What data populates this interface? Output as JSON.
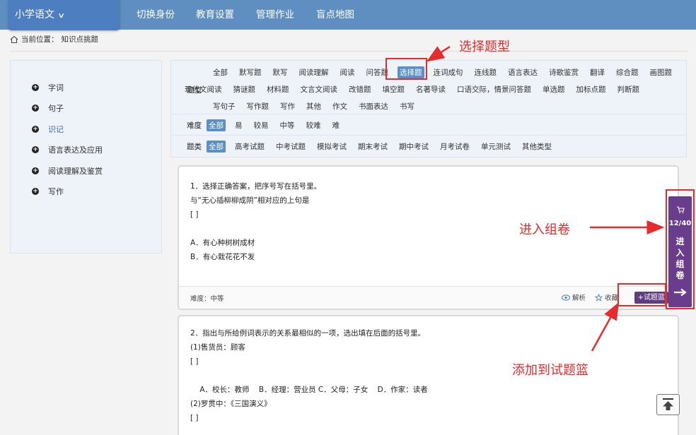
{
  "header": {
    "subject": "小学语文",
    "nav": [
      "切换身份",
      "教育设置",
      "管理作业",
      "盲点地图"
    ]
  },
  "breadcrumb": {
    "label": "当前位置：",
    "page": "知识点挑题"
  },
  "sidebar": {
    "items": [
      {
        "label": "字词",
        "active": false
      },
      {
        "label": "句子",
        "active": false
      },
      {
        "label": "识记",
        "active": true
      },
      {
        "label": "语言表达及应用",
        "active": false
      },
      {
        "label": "阅读理解及鉴赏",
        "active": false
      },
      {
        "label": "写作",
        "active": false
      }
    ]
  },
  "filters": {
    "type_label": "题型",
    "type_rows": [
      [
        "全部",
        "默写题",
        "默写",
        "阅读理解",
        "阅读",
        "问答题",
        "选择题",
        "连词成句",
        "连线题",
        "语言表达",
        "诗歌鉴赏",
        "翻译",
        "综合题",
        "画图题"
      ],
      [
        "现代文阅读",
        "猜谜题",
        "材料题",
        "文言文阅读",
        "改错题",
        "填空题",
        "名著导读",
        "口语交际，情景问答题",
        "单选题",
        "加标点题",
        "判断题"
      ],
      [
        "写句子",
        "写作题",
        "写作",
        "其他",
        "作文",
        "书面表达",
        "书写"
      ]
    ],
    "type_selected": "选择题",
    "difficulty_label": "难度",
    "difficulty": [
      "全部",
      "易",
      "较易",
      "中等",
      "较难",
      "难"
    ],
    "difficulty_selected": "全部",
    "category_label": "题类",
    "category": [
      "全部",
      "高考试题",
      "中考试题",
      "模拟考试",
      "期末考试",
      "期中考试",
      "月考试卷",
      "单元测试",
      "其他类型"
    ],
    "category_selected": "全部"
  },
  "questions": [
    {
      "lines": [
        "1．选择正确答案，把序号写在括号里。",
        "与“无心插柳柳成阴”相对应的上句是",
        "[    ]",
        "",
        "A．有心种树树成材",
        "B．有心栽花花不发"
      ],
      "difficulty": "难度：中等",
      "analysis": "解析",
      "favorite": "收藏",
      "add_basket": "+试题篮"
    },
    {
      "lines": [
        "2．指出与所给例词表示的关系最相似的一项，选出填在后面的括号里。",
        "(1)售货员：顾客",
        "[    ]",
        "",
        "    A．校长：教师    B．经理：营业员 C．父母：子女    D．作家：读者",
        "(2)罗贯中：《三国演义》",
        "[    ]"
      ]
    }
  ],
  "cart": {
    "count": "12/40",
    "label": "进入组卷",
    "cart_icon": "cart-icon",
    "arrow_icon": "arrow-right-icon"
  },
  "annotations": {
    "select_type": "选择题型",
    "enter_paper": "进入组卷",
    "add_basket": "添加到试题篮"
  },
  "colors": {
    "header": "#5f8fc1",
    "accent": "#5b8fc8",
    "cart": "#6a3d8c",
    "annotation": "#e52b2b"
  }
}
